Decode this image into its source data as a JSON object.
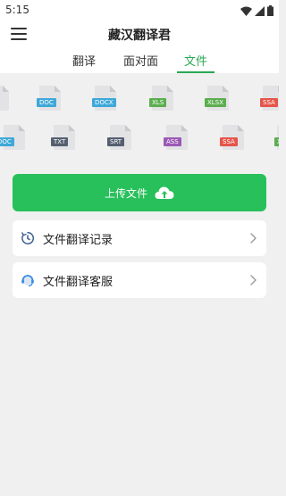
{
  "status": {
    "time": "5:15"
  },
  "appbar": {
    "title": "藏汉翻译君"
  },
  "tabs": [
    {
      "label": "翻译",
      "active": false
    },
    {
      "label": "面对面",
      "active": false
    },
    {
      "label": "文件",
      "active": true
    }
  ],
  "file_types": [
    {
      "label": "DOC",
      "color": "#3fa8d8"
    },
    {
      "label": "DOCX",
      "color": "#3fa8d8"
    },
    {
      "label": "XLS",
      "color": "#5bae4f"
    },
    {
      "label": "XLSX",
      "color": "#5bae4f"
    },
    {
      "label": "SSA",
      "color": "#e5554a"
    },
    {
      "label": "DOC",
      "color": "#3fa8d8"
    },
    {
      "label": "TXT",
      "color": "#555f70"
    },
    {
      "label": "SRT",
      "color": "#555f70"
    },
    {
      "label": "ASS",
      "color": "#9b59b6"
    },
    {
      "label": "SSA",
      "color": "#e5554a"
    },
    {
      "label": "X",
      "color": "#5bae4f"
    }
  ],
  "upload": {
    "label": "上传文件",
    "icon": "cloud-upload-icon",
    "color": "#27c05a"
  },
  "menu": [
    {
      "label": "文件翻译记录",
      "icon": "history-clock-icon"
    },
    {
      "label": "文件翻译客服",
      "icon": "customer-service-icon"
    }
  ]
}
